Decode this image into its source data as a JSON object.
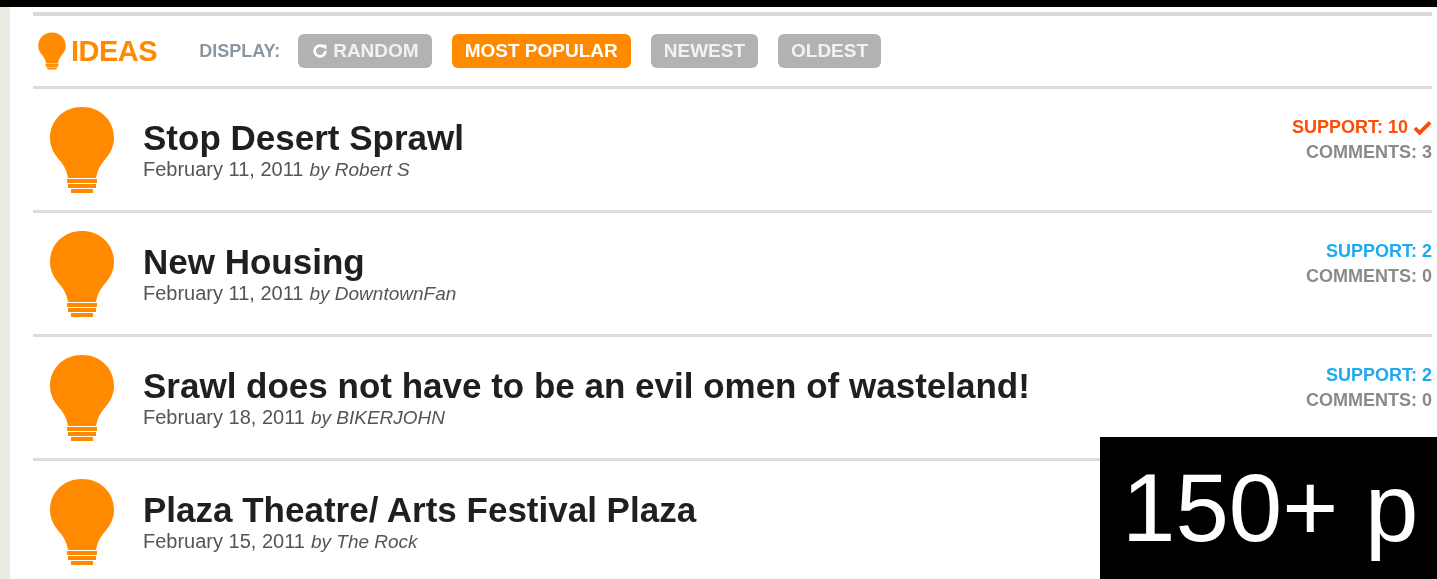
{
  "header": {
    "title": "IDEAS",
    "display_label": "DISPLAY:"
  },
  "sort_options": [
    {
      "label": "RANDOM",
      "kind": "refresh",
      "selected": false
    },
    {
      "label": "MOST POPULAR",
      "kind": "plain",
      "selected": true
    },
    {
      "label": "NEWEST",
      "kind": "plain",
      "selected": false
    },
    {
      "label": "OLDEST",
      "kind": "plain",
      "selected": false
    }
  ],
  "ideas": [
    {
      "title": "Stop Desert Sprawl",
      "date": "February 11, 2011",
      "author": "by Robert S",
      "support": "SUPPORT: 10",
      "supported": true,
      "comments": "COMMENTS: 3"
    },
    {
      "title": "New Housing",
      "date": "February 11, 2011",
      "author": "by DowntownFan",
      "support": "SUPPORT: 2",
      "supported": false,
      "comments": "COMMENTS: 0"
    },
    {
      "title": "Srawl does not have to be an evil omen of wasteland!",
      "date": "February 18, 2011",
      "author": "by BIKERJOHN",
      "support": "SUPPORT: 2",
      "supported": false,
      "comments": "COMMENTS: 0"
    },
    {
      "title": "Plaza Theatre/ Arts Festival Plaza",
      "date": "February 15, 2011",
      "author": "by The Rock"
    }
  ],
  "overlay": {
    "text": "150+ p"
  }
}
